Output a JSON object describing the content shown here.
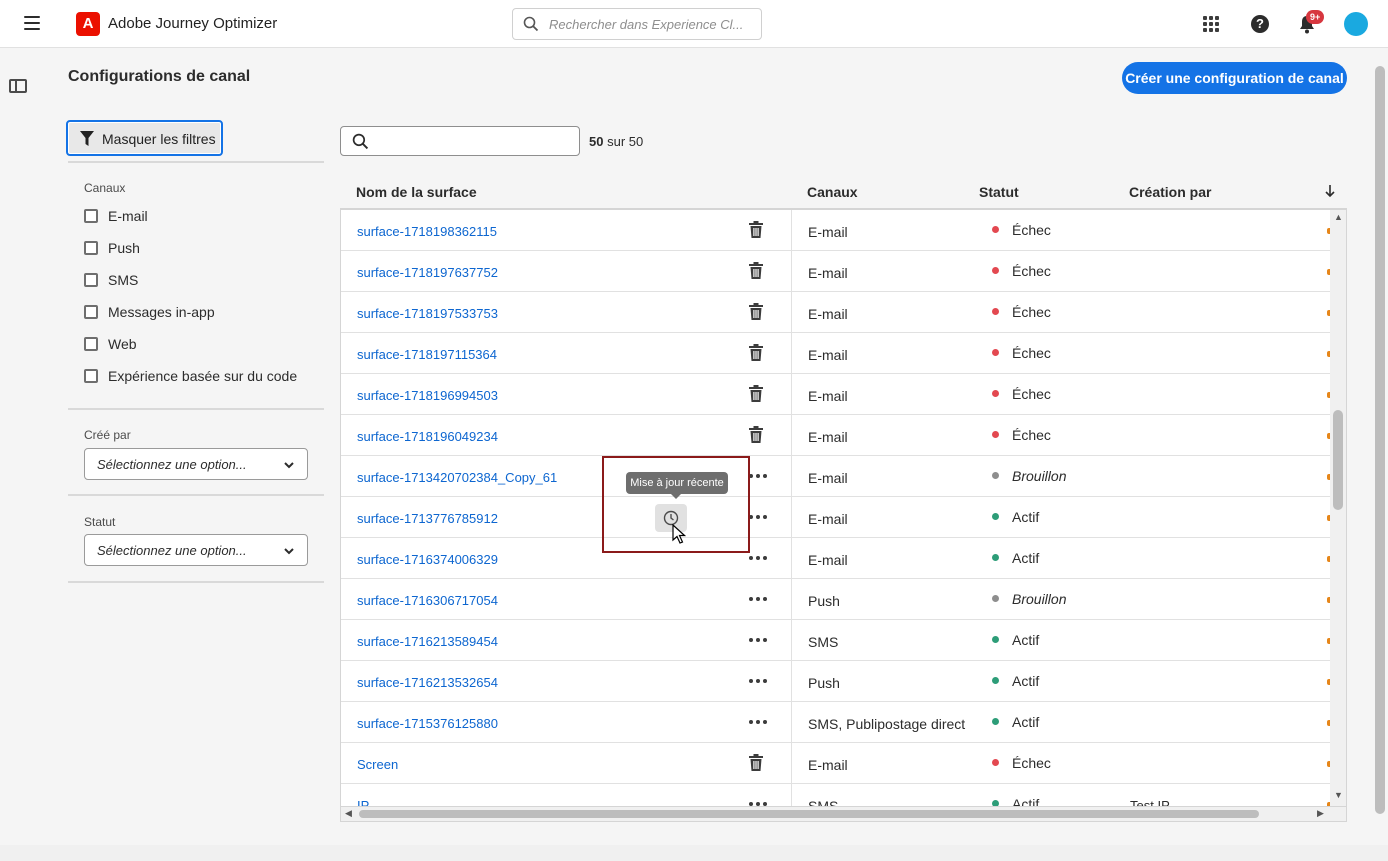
{
  "header": {
    "app_title": "Adobe Journey Optimizer",
    "logo_letter": "A",
    "search_placeholder": "Rechercher dans Experience Cl...",
    "notification_badge": "9+",
    "brand_color": "#eb1000",
    "accent_color": "#1473e6"
  },
  "page": {
    "title": "Configurations de canal",
    "create_button": "Créer une configuration de canal"
  },
  "filters": {
    "toggle_label": "Masquer les filtres",
    "channels_label": "Canaux",
    "channels": [
      "E-mail",
      "Push",
      "SMS",
      "Messages in-app",
      "Web",
      "Expérience basée sur du code"
    ],
    "created_by_label": "Créé par",
    "created_by_value": "Sélectionnez une option...",
    "status_label": "Statut",
    "status_value": "Sélectionnez une option..."
  },
  "table": {
    "count_shown": "50",
    "count_text": "sur 50",
    "columns": [
      "Nom de la surface",
      "Canaux",
      "Statut",
      "Création par"
    ],
    "rows": [
      {
        "name": "surface-1718198362115",
        "action": "trash",
        "channel": "E-mail",
        "status": "Échec",
        "status_color": "#e34850",
        "created_by": ""
      },
      {
        "name": "surface-1718197637752",
        "action": "trash",
        "channel": "E-mail",
        "status": "Échec",
        "status_color": "#e34850",
        "created_by": ""
      },
      {
        "name": "surface-1718197533753",
        "action": "trash",
        "channel": "E-mail",
        "status": "Échec",
        "status_color": "#e34850",
        "created_by": ""
      },
      {
        "name": "surface-1718197115364",
        "action": "trash",
        "channel": "E-mail",
        "status": "Échec",
        "status_color": "#e34850",
        "created_by": ""
      },
      {
        "name": "surface-1718196994503",
        "action": "trash",
        "channel": "E-mail",
        "status": "Échec",
        "status_color": "#e34850",
        "created_by": ""
      },
      {
        "name": "surface-1718196049234",
        "action": "trash",
        "channel": "E-mail",
        "status": "Échec",
        "status_color": "#e34850",
        "created_by": ""
      },
      {
        "name": "surface-1713420702384_Copy_61",
        "action": "more",
        "channel": "E-mail",
        "status": "Brouillon",
        "status_color": "#8e8e8e",
        "created_by": ""
      },
      {
        "name": "surface-1713776785912",
        "action": "more",
        "channel": "E-mail",
        "status": "Actif",
        "status_color": "#2d9d78",
        "created_by": ""
      },
      {
        "name": "surface-1716374006329",
        "action": "more",
        "channel": "E-mail",
        "status": "Actif",
        "status_color": "#2d9d78",
        "created_by": ""
      },
      {
        "name": "surface-1716306717054",
        "action": "more",
        "channel": "Push",
        "status": "Brouillon",
        "status_color": "#8e8e8e",
        "created_by": ""
      },
      {
        "name": "surface-1716213589454",
        "action": "more",
        "channel": "SMS",
        "status": "Actif",
        "status_color": "#2d9d78",
        "created_by": ""
      },
      {
        "name": "surface-1716213532654",
        "action": "more",
        "channel": "Push",
        "status": "Actif",
        "status_color": "#2d9d78",
        "created_by": ""
      },
      {
        "name": "surface-1715376125880",
        "action": "more",
        "channel": "SMS, Publipostage direct",
        "status": "Actif",
        "status_color": "#2d9d78",
        "created_by": ""
      },
      {
        "name": "Screen",
        "action": "trash",
        "channel": "E-mail",
        "status": "Échec",
        "status_color": "#e34850",
        "created_by": ""
      },
      {
        "name": "IP",
        "action": "more",
        "channel": "SMS",
        "status": "Actif",
        "status_color": "#2d9d78",
        "created_by": "Test IP"
      }
    ]
  },
  "tooltip": {
    "text": "Mise à jour récente"
  }
}
